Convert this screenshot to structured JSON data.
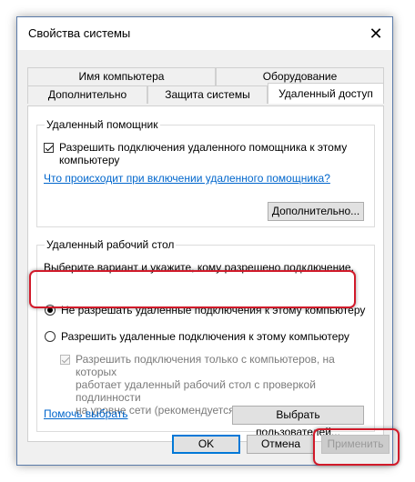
{
  "window": {
    "title": "Свойства системы"
  },
  "tabs": {
    "row1": [
      "Имя компьютера",
      "Оборудование"
    ],
    "row2": [
      "Дополнительно",
      "Защита системы",
      "Удаленный доступ"
    ],
    "active": "Удаленный доступ"
  },
  "assistance": {
    "group_title": "Удаленный помощник",
    "checkbox_label_line1": "Разрешить подключения удаленного помощника к этому",
    "checkbox_label_line2": "компьютеру",
    "checkbox_checked": true,
    "link": "Что происходит при включении удаленного помощника?",
    "advanced_button": "Дополнительно..."
  },
  "desktop": {
    "group_title": "Удаленный рабочий стол",
    "instruction": "Выберите вариант и укажите, кому разрешено подключение.",
    "radio_deny": "Не разрешать удаленные подключения к этому компьютеру",
    "radio_allow": "Разрешить удаленные подключения к этому компьютеру",
    "selected": "deny",
    "nla_line1": "Разрешить подключения только с компьютеров, на которых",
    "nla_line2": "работает удаленный рабочий стол с проверкой подлинности",
    "nla_line3": "на уровне сети (рекомендуется)",
    "nla_checked": true,
    "help_link": "Помочь выбрать",
    "select_users_button": "Выбрать пользователей..."
  },
  "footer": {
    "ok": "OK",
    "cancel": "Отмена",
    "apply": "Применить"
  },
  "colors": {
    "highlight": "#d11a2a",
    "link": "#0066cc",
    "accent": "#0078d7"
  },
  "icons": {
    "close": "close-icon"
  }
}
